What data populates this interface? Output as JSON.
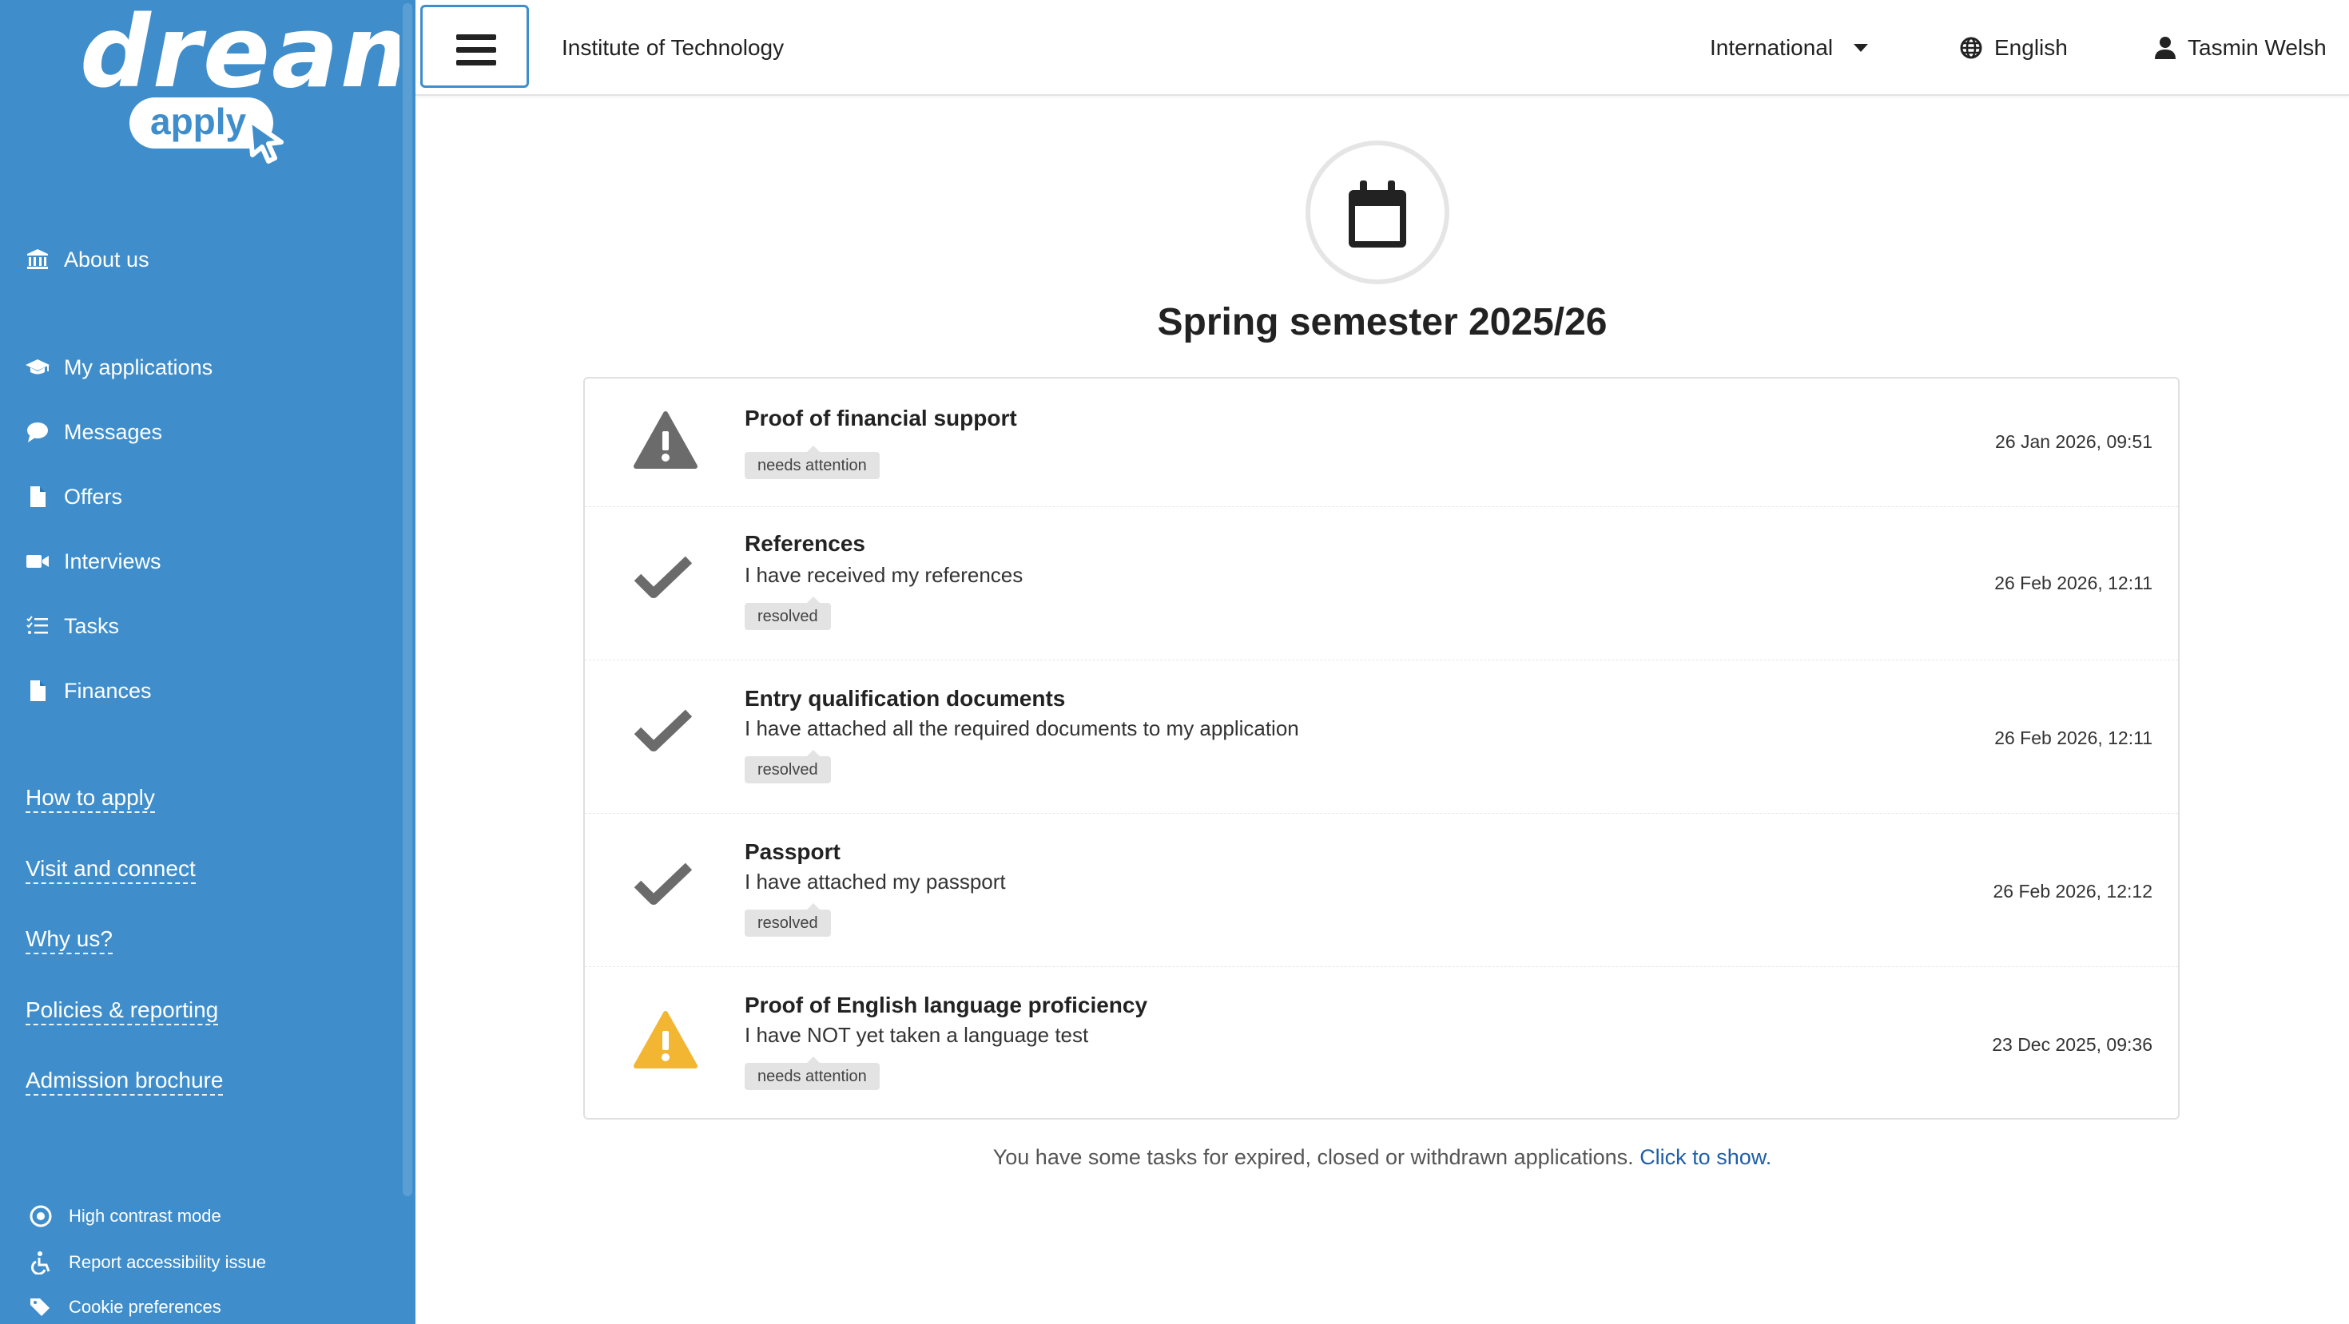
{
  "colors": {
    "sidebar": "#3f8ecb",
    "accent": "#1f5ea8",
    "warning": "#f2b632",
    "icon_gray": "#6b6b6b"
  },
  "brand": {
    "logo_text_main": "dream",
    "logo_text_sub": "apply"
  },
  "sidebar": {
    "about": {
      "label": "About us",
      "icon": "institution-icon"
    },
    "nav": [
      {
        "label": "My applications",
        "icon": "graduation-cap-icon"
      },
      {
        "label": "Messages",
        "icon": "chat-bubble-icon"
      },
      {
        "label": "Offers",
        "icon": "document-icon"
      },
      {
        "label": "Interviews",
        "icon": "video-camera-icon"
      },
      {
        "label": "Tasks",
        "icon": "checklist-icon"
      },
      {
        "label": "Finances",
        "icon": "document-icon"
      }
    ],
    "links": [
      "How to apply",
      "Visit and connect",
      "Why us?",
      "Policies & reporting",
      "Admission brochure"
    ],
    "utilities": [
      {
        "label": "High contrast mode",
        "icon": "contrast-icon"
      },
      {
        "label": "Report accessibility issue",
        "icon": "accessibility-icon"
      },
      {
        "label": "Cookie preferences",
        "icon": "tags-icon"
      }
    ]
  },
  "topbar": {
    "institution": "Institute of Technology",
    "region": "International",
    "language": "English",
    "user": "Tasmin Welsh"
  },
  "main": {
    "semester_title": "Spring semester 2025/26",
    "tasks": [
      {
        "status": "warning-gray",
        "title": "Proof of financial support",
        "description": "",
        "badge": "needs attention",
        "date": "26 Jan 2026, 09:51"
      },
      {
        "status": "done",
        "title": "References",
        "description": "I have received my references",
        "badge": "resolved",
        "date": "26 Feb 2026, 12:11"
      },
      {
        "status": "done",
        "title": "Entry qualification documents",
        "description": "I have attached all the required documents to my application",
        "badge": "resolved",
        "date": "26 Feb 2026, 12:11"
      },
      {
        "status": "done",
        "title": "Passport",
        "description": "I have attached my passport",
        "badge": "resolved",
        "date": "26 Feb 2026, 12:12"
      },
      {
        "status": "warning-yellow",
        "title": "Proof of English language proficiency",
        "description": "I have NOT yet taken a language test",
        "badge": "needs attention",
        "date": "23 Dec 2025, 09:36"
      }
    ],
    "footer_text": "You have some tasks for expired, closed or withdrawn applications.",
    "footer_link": "Click to show."
  }
}
